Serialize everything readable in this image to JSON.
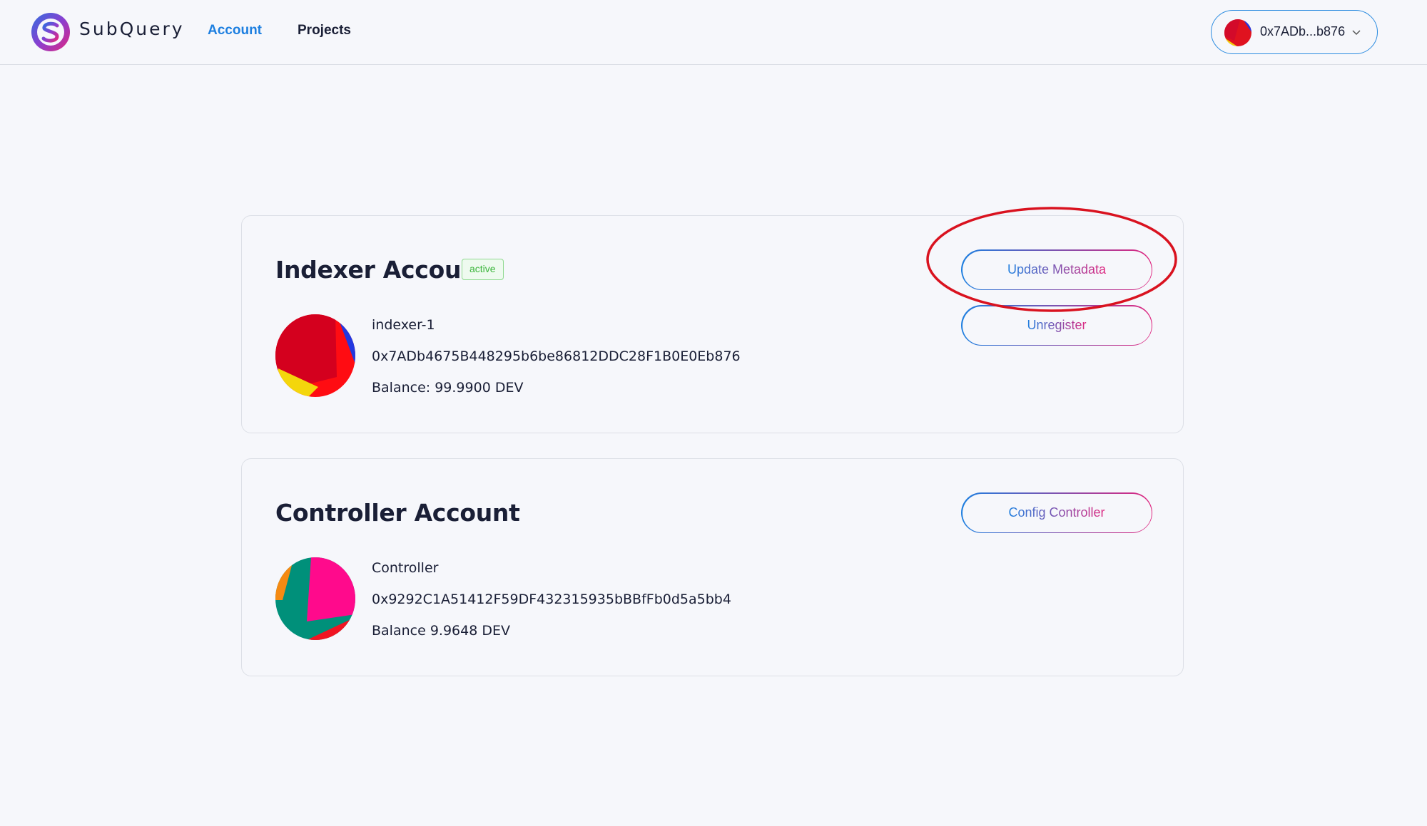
{
  "header": {
    "brand": "SubQuery",
    "nav": [
      {
        "label": "Account",
        "active": true
      },
      {
        "label": "Projects",
        "active": false
      }
    ],
    "wallet": {
      "address": "0x7ADb...b876"
    }
  },
  "indexer": {
    "title": "Indexer Account",
    "status": "active",
    "name": "indexer-1",
    "address": "0x7ADb4675B448295b6be86812DDC28F1B0E0Eb876",
    "balance": "Balance: 99.9900 DEV",
    "buttons": {
      "update": "Update Metadata",
      "unregister": "Unregister"
    }
  },
  "controller": {
    "title": "Controller Account",
    "name": "Controller",
    "address": "0x9292C1A51412F59DF432315935bBBfFb0d5a5bb4",
    "balance": "Balance 9.9648 DEV",
    "buttons": {
      "config": "Config Controller"
    }
  },
  "colors": {
    "accent_blue": "#1d7fe0",
    "accent_pink": "#e0267f",
    "status_green": "#3bb53b",
    "annotation_red": "#d9121f"
  }
}
